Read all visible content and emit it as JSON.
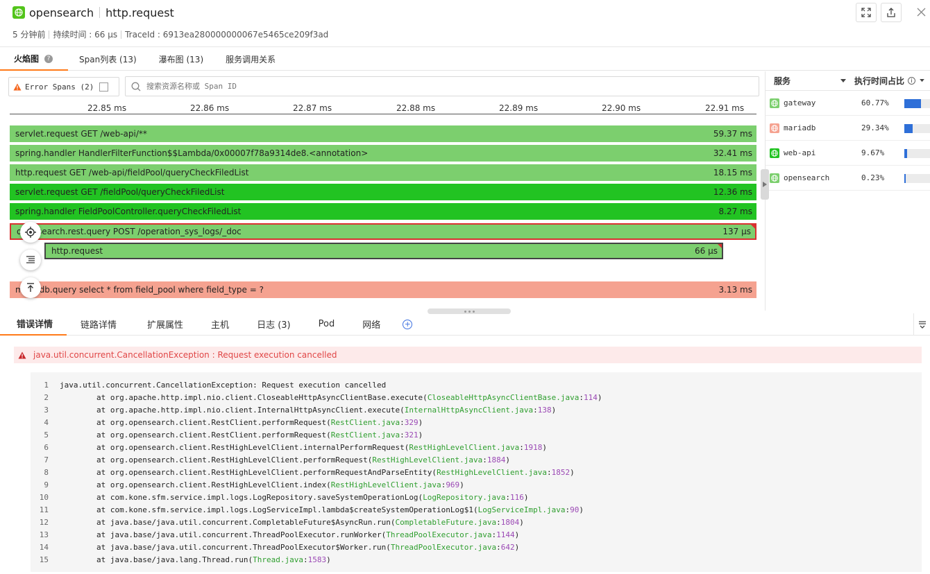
{
  "header": {
    "service": "opensearch",
    "operation": "http.request",
    "time_ago": "5 分钟前",
    "duration": "持续时间 : 66 µs",
    "trace_id": "TraceId : 6913ea280000000067e5465ce209f3ad"
  },
  "tabs": [
    {
      "label": "火焰图"
    },
    {
      "label": "Span列表 (13)"
    },
    {
      "label": "瀑布图 (13)"
    },
    {
      "label": "服务调用关系"
    }
  ],
  "filter": {
    "error_spans_label": "Error Spans (2)",
    "search_placeholder": "搜索资源名称或 Span ID"
  },
  "axis_ticks": [
    "22.85 ms",
    "22.86 ms",
    "22.87 ms",
    "22.88 ms",
    "22.89 ms",
    "22.90 ms",
    "22.91 ms"
  ],
  "spans": [
    {
      "label": "servlet.request GET /web-api/**",
      "duration": "59.37 ms",
      "service": "gateway",
      "error": false
    },
    {
      "label": "spring.handler HandlerFilterFunction$$Lambda/0x00007f78a9314de8.<annotation>",
      "duration": "32.41 ms",
      "service": "gateway",
      "error": false
    },
    {
      "label": "http.request GET /web-api/fieldPool/queryCheckFiledList",
      "duration": "18.15 ms",
      "service": "gateway",
      "error": false
    },
    {
      "label": "servlet.request GET /fieldPool/queryCheckFiledList",
      "duration": "12.36 ms",
      "service": "web-api",
      "error": false
    },
    {
      "label": "spring.handler FieldPoolController.queryCheckFiledList",
      "duration": "8.27 ms",
      "service": "web-api",
      "error": false
    },
    {
      "label": "opensearch.rest.query POST /operation_sys_logs/_doc",
      "duration": "137 µs",
      "service": "gateway",
      "error": true
    },
    {
      "label": "http.request",
      "duration": "66 µs",
      "service": "gateway",
      "error": true
    },
    {
      "label": "mariadb.query select * from field_pool where field_type = ?",
      "duration": "3.13 ms",
      "service": "mariadb",
      "error": false
    }
  ],
  "services_panel": {
    "col_service": "服务",
    "col_ratio": "执行时间占比",
    "rows": [
      {
        "name": "gateway",
        "pct": "60.77%",
        "ratio": 0.6077,
        "color": "#7ccf6e"
      },
      {
        "name": "mariadb",
        "pct": "29.34%",
        "ratio": 0.2934,
        "color": "#f5a290"
      },
      {
        "name": "web-api",
        "pct": "9.67%",
        "ratio": 0.0967,
        "color": "#22c322"
      },
      {
        "name": "opensearch",
        "pct": "0.23%",
        "ratio": 0.0023,
        "color": "#7ccf6e"
      }
    ]
  },
  "detail_tabs": [
    {
      "label": "错误详情"
    },
    {
      "label": "链路详情"
    },
    {
      "label": "扩展属性"
    },
    {
      "label": "主机"
    },
    {
      "label": "日志 (3)"
    },
    {
      "label": "Pod"
    },
    {
      "label": "网络"
    }
  ],
  "error": {
    "message": "java.util.concurrent.CancellationException : Request execution cancelled",
    "stack": [
      {
        "n": "1",
        "text": "java.util.concurrent.CancellationException: Request execution cancelled",
        "file": "",
        "line": ""
      },
      {
        "n": "2",
        "text": "        at org.apache.http.impl.nio.client.CloseableHttpAsyncClientBase.execute(",
        "file": "CloseableHttpAsyncClientBase.java",
        "line": "114"
      },
      {
        "n": "3",
        "text": "        at org.apache.http.impl.nio.client.InternalHttpAsyncClient.execute(",
        "file": "InternalHttpAsyncClient.java",
        "line": "138"
      },
      {
        "n": "4",
        "text": "        at org.opensearch.client.RestClient.performRequest(",
        "file": "RestClient.java",
        "line": "329"
      },
      {
        "n": "5",
        "text": "        at org.opensearch.client.RestClient.performRequest(",
        "file": "RestClient.java",
        "line": "321"
      },
      {
        "n": "6",
        "text": "        at org.opensearch.client.RestHighLevelClient.internalPerformRequest(",
        "file": "RestHighLevelClient.java",
        "line": "1918"
      },
      {
        "n": "7",
        "text": "        at org.opensearch.client.RestHighLevelClient.performRequest(",
        "file": "RestHighLevelClient.java",
        "line": "1884"
      },
      {
        "n": "8",
        "text": "        at org.opensearch.client.RestHighLevelClient.performRequestAndParseEntity(",
        "file": "RestHighLevelClient.java",
        "line": "1852"
      },
      {
        "n": "9",
        "text": "        at org.opensearch.client.RestHighLevelClient.index(",
        "file": "RestHighLevelClient.java",
        "line": "969"
      },
      {
        "n": "10",
        "text": "        at com.kone.sfm.service.impl.logs.LogRepository.saveSystemOperationLog(",
        "file": "LogRepository.java",
        "line": "116"
      },
      {
        "n": "11",
        "text": "        at com.kone.sfm.service.impl.logs.LogServiceImpl.lambda$createSystemOperationLog$1(",
        "file": "LogServiceImpl.java",
        "line": "90"
      },
      {
        "n": "12",
        "text": "        at java.base/java.util.concurrent.CompletableFuture$AsyncRun.run(",
        "file": "CompletableFuture.java",
        "line": "1804"
      },
      {
        "n": "13",
        "text": "        at java.base/java.util.concurrent.ThreadPoolExecutor.runWorker(",
        "file": "ThreadPoolExecutor.java",
        "line": "1144"
      },
      {
        "n": "14",
        "text": "        at java.base/java.util.concurrent.ThreadPoolExecutor$Worker.run(",
        "file": "ThreadPoolExecutor.java",
        "line": "642"
      },
      {
        "n": "15",
        "text": "        at java.base/java.lang.Thread.run(",
        "file": "Thread.java",
        "line": "1583"
      }
    ]
  }
}
